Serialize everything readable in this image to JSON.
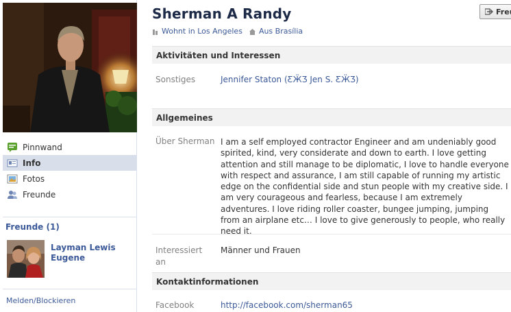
{
  "profile": {
    "name": "Sherman A Randy",
    "lives_in": "Wohnt in Los Angeles",
    "from": "Aus Brasília",
    "message_button": "Freu"
  },
  "nav": {
    "items": [
      {
        "label": "Pinnwand",
        "icon": "wall-icon"
      },
      {
        "label": "Info",
        "icon": "info-icon"
      },
      {
        "label": "Fotos",
        "icon": "photos-icon"
      },
      {
        "label": "Freunde",
        "icon": "friends-icon"
      }
    ]
  },
  "friends": {
    "title": "Freunde (1)",
    "items": [
      {
        "name": "Layman Lewis Eugene"
      }
    ]
  },
  "report_link": "Melden/Blockieren",
  "sections": {
    "activities": {
      "heading": "Aktivitäten und Interessen",
      "other_label": "Sonstiges",
      "other_value": "Jennifer Staton (ƸӜƷ Jen S. ƸӜƷ)"
    },
    "general": {
      "heading": "Allgemeines",
      "about_label": "Über Sherman",
      "about_value": "I am a self employed contractor Engineer and am undeniably good spirited, kind, very considerate and down to earth. I love getting attention and still manage to be diplomatic, I love to handle everyone with respect and assurance, I am still capable of running my artistic edge on the confidential side and stun people with my creative side. I am very courageous and fearless, because I am extremely adventures. I love riding roller coaster, bungee jumping, jumping from an airplane etc… I love to give generously to people, who really need it.",
      "interested_label": "Interessiert an",
      "interested_value": "Männer und Frauen"
    },
    "contact": {
      "heading": "Kontaktinformationen",
      "facebook_label": "Facebook",
      "facebook_value": "http://facebook.com/sherman65"
    }
  },
  "colors": {
    "link": "#3b5998",
    "name": "#1c2a47",
    "nav_active_bg": "#d8dfea",
    "section_bg": "#f2f2f2"
  }
}
